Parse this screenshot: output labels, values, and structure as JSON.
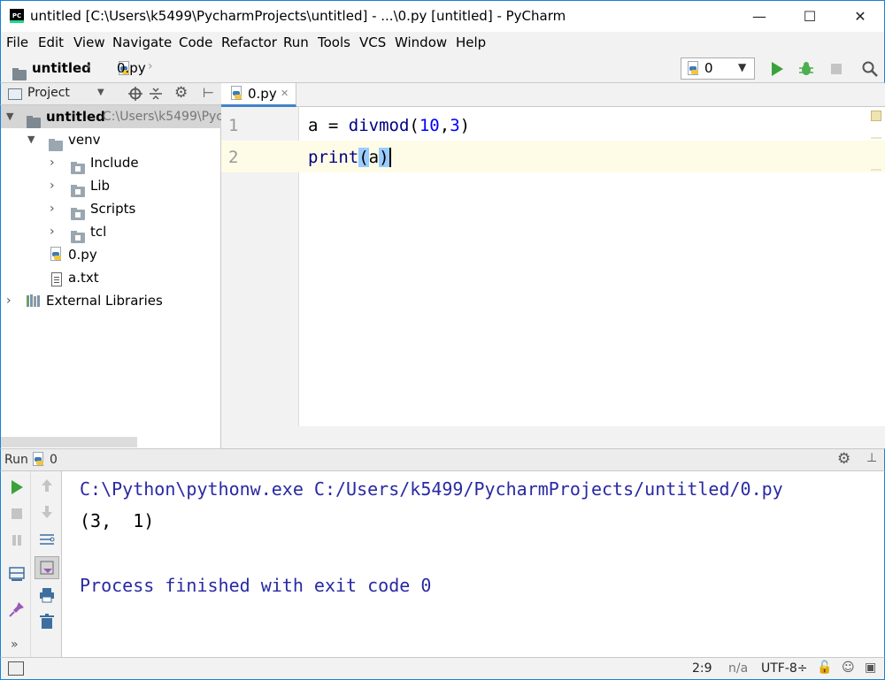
{
  "window": {
    "title": "untitled [C:\\Users\\k5499\\PycharmProjects\\untitled] - ...\\0.py [untitled] - PyCharm",
    "app_icon_text": "PC",
    "minimize": "—",
    "maximize": "☐",
    "close": "✕"
  },
  "menu": [
    "File",
    "Edit",
    "View",
    "Navigate",
    "Code",
    "Refactor",
    "Run",
    "Tools",
    "VCS",
    "Window",
    "Help"
  ],
  "navbar": {
    "breadcrumb_project": "untitled",
    "breadcrumb_file": "0.py",
    "run_config": "0"
  },
  "project_panel": {
    "title": "Project",
    "root_name": "untitled",
    "root_path": "C:\\Users\\k5499\\Pyc",
    "items": [
      {
        "label": "venv"
      },
      {
        "label": "Include"
      },
      {
        "label": "Lib"
      },
      {
        "label": "Scripts"
      },
      {
        "label": "tcl"
      },
      {
        "label": "0.py"
      },
      {
        "label": "a.txt"
      },
      {
        "label": "External Libraries"
      }
    ]
  },
  "editor": {
    "tab_label": "0.py",
    "line_numbers": [
      "1",
      "2"
    ],
    "code": {
      "l1_a": "a = ",
      "l1_fn": "divmod",
      "l1_open": "(",
      "l1_n1": "10",
      "l1_comma": ",",
      "l1_n2": "3",
      "l1_close": ")",
      "l2_fn": "print",
      "l2_open": "(",
      "l2_arg": "a",
      "l2_close": ")"
    }
  },
  "run_panel": {
    "label": "Run",
    "config_name": "0",
    "console_lines": [
      "C:\\Python\\pythonw.exe C:/Users/k5499/PycharmProjects/untitled/0.py",
      "(3,  1)",
      "",
      "Process finished with exit code 0"
    ],
    "console_color": "#2929a3",
    "more_label": "»"
  },
  "statusbar": {
    "position": "2:9",
    "line_sep": "n/a",
    "encoding": "UTF-8÷"
  },
  "colors": {
    "accent": "#4083c9",
    "run_green": "#3aa23a",
    "window_border": "#1a82d6"
  }
}
